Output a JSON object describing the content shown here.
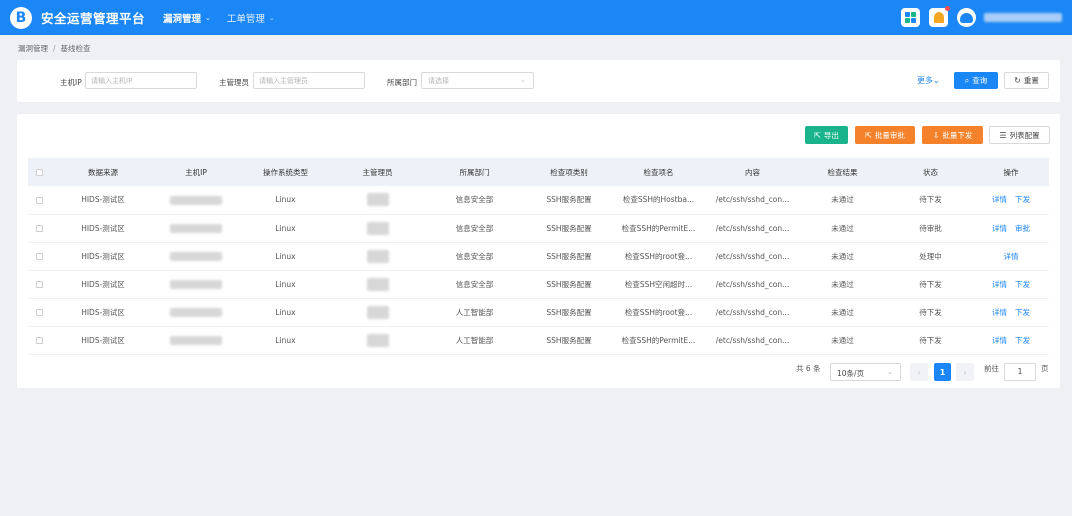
{
  "header": {
    "logo_letter": "B",
    "app_title": "安全运营管理平台",
    "nav": [
      {
        "label": "漏洞管理",
        "active": true
      },
      {
        "label": "工单管理",
        "active": false
      }
    ],
    "chevron": "⌄"
  },
  "breadcrumb": {
    "items": [
      "漏洞管理",
      "基线检查"
    ],
    "separator": "/"
  },
  "filters": {
    "host_ip_label": "主机IP",
    "host_ip_placeholder": "请输入主机IP",
    "owner_label": "主管理员",
    "owner_placeholder": "请输入主管理员",
    "dept_label": "所属部门",
    "dept_placeholder": "请选择",
    "more_label": "更多",
    "query_label": "查询",
    "reset_label": "重置"
  },
  "toolbar": {
    "export_label": "导出",
    "batch_approve_label": "批量审批",
    "batch_issue_label": "批量下发",
    "column_config_label": "列表配置"
  },
  "table": {
    "columns": [
      "数据来源",
      "主机IP",
      "操作系统类型",
      "主管理员",
      "所属部门",
      "检查项类别",
      "检查项名",
      "内容",
      "检查结果",
      "状态",
      "操作"
    ],
    "rows": [
      {
        "source": "HIDS-测试区",
        "os": "Linux",
        "dept": "信息安全部",
        "category": "SSH服务配置",
        "item": "检查SSH的Hostba...",
        "content": "/etc/ssh/sshd_con...",
        "result": "未通过",
        "status": "待下发",
        "actions": [
          "详情",
          "下发"
        ]
      },
      {
        "source": "HIDS-测试区",
        "os": "Linux",
        "dept": "信息安全部",
        "category": "SSH服务配置",
        "item": "检查SSH的PermitE...",
        "content": "/etc/ssh/sshd_con...",
        "result": "未通过",
        "status": "待审批",
        "actions": [
          "详情",
          "审批"
        ]
      },
      {
        "source": "HIDS-测试区",
        "os": "Linux",
        "dept": "信息安全部",
        "category": "SSH服务配置",
        "item": "检查SSH的root登...",
        "content": "/etc/ssh/sshd_con...",
        "result": "未通过",
        "status": "处理中",
        "actions": [
          "详情"
        ]
      },
      {
        "source": "HIDS-测试区",
        "os": "Linux",
        "dept": "信息安全部",
        "category": "SSH服务配置",
        "item": "检查SSH空闲超时...",
        "content": "/etc/ssh/sshd_con...",
        "result": "未通过",
        "status": "待下发",
        "actions": [
          "详情",
          "下发"
        ]
      },
      {
        "source": "HIDS-测试区",
        "os": "Linux",
        "dept": "人工智能部",
        "category": "SSH服务配置",
        "item": "检查SSH的root登...",
        "content": "/etc/ssh/sshd_con...",
        "result": "未通过",
        "status": "待下发",
        "actions": [
          "详情",
          "下发"
        ]
      },
      {
        "source": "HIDS-测试区",
        "os": "Linux",
        "dept": "人工智能部",
        "category": "SSH服务配置",
        "item": "检查SSH的PermitE...",
        "content": "/etc/ssh/sshd_con...",
        "result": "未通过",
        "status": "待下发",
        "actions": [
          "详情",
          "下发"
        ]
      }
    ]
  },
  "pagination": {
    "total_text": "共 6 条",
    "page_size": "10条/页",
    "current_page": "1",
    "jump_label": "前往",
    "jump_value": "1",
    "page_unit": "页",
    "prev": "‹",
    "next": "›"
  },
  "colors": {
    "primary": "#1b86f5",
    "export": "#19b38c",
    "batch": "#f5822a"
  }
}
